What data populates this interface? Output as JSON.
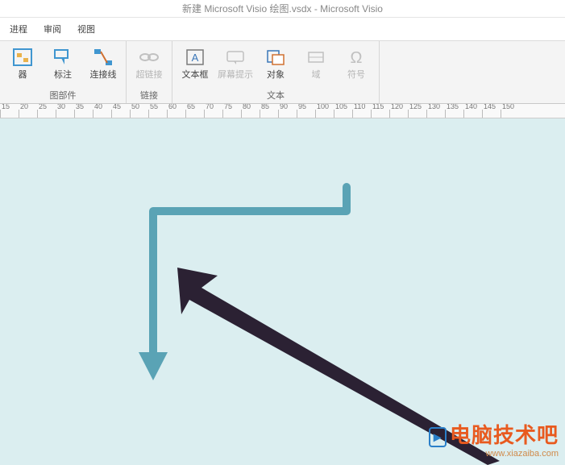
{
  "titlebar": "新建 Microsoft Visio 绘图.vsdx - Microsoft Visio",
  "tabs": {
    "process": "进程",
    "review": "审阅",
    "view": "视图"
  },
  "ribbon": {
    "group_parts": {
      "label": "图部件",
      "container": "器",
      "callout": "标注",
      "connector": "连接线"
    },
    "group_links": {
      "label": "链接",
      "hyperlink": "超链接"
    },
    "group_text": {
      "label": "文本",
      "textbox": "文本框",
      "screentip": "屏幕提示",
      "object": "对象",
      "field": "域",
      "symbol": "符号"
    }
  },
  "ruler": {
    "ticks": [
      "15",
      "20",
      "25",
      "30",
      "35",
      "40",
      "45",
      "50",
      "55",
      "60",
      "65",
      "70",
      "75",
      "80",
      "85",
      "90",
      "95",
      "100",
      "105",
      "110",
      "115",
      "120",
      "125",
      "130",
      "135",
      "140",
      "145",
      "150"
    ]
  },
  "shapes": {
    "elbow_connector": {
      "color": "#5aa3b5",
      "stroke_width": 10
    },
    "cursor_arrow": {
      "color": "#2b2133"
    }
  },
  "watermark": {
    "brand": "电脑技术吧",
    "url": "www.xiazaiba.com"
  }
}
